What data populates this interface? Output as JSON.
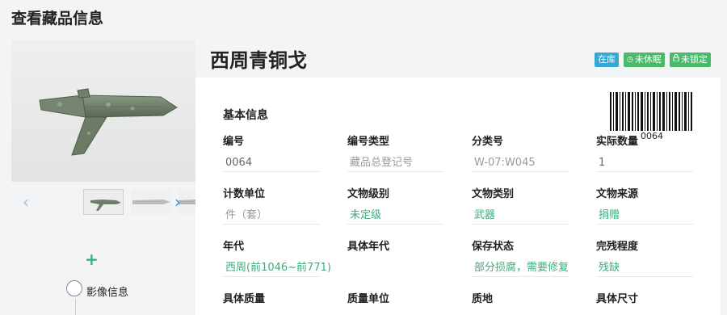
{
  "page": {
    "title": "查看藏品信息"
  },
  "object": {
    "title": "西周青铜戈",
    "badges": [
      {
        "label": "在库",
        "color": "#35a9d4"
      },
      {
        "label": "未休眠",
        "icon": "clock-icon",
        "color": "#4cb86a"
      },
      {
        "label": "未锁定",
        "icon": "lock-icon",
        "color": "#4cb86a"
      }
    ],
    "barcode_number": "0064"
  },
  "sidebar": {
    "media_label": "影像信息",
    "add_icon": "plus-icon",
    "prev_icon": "chevron-left-icon",
    "next_icon": "chevron-right-icon"
  },
  "basic_info": {
    "title": "基本信息",
    "fields": [
      {
        "label": "编号",
        "value": "0064"
      },
      {
        "label": "编号类型",
        "value": "藏品总登记号"
      },
      {
        "label": "分类号",
        "value": "W-07:W045"
      },
      {
        "label": "实际数量",
        "value": "1"
      },
      {
        "label": "计数单位",
        "value": "件（套）"
      },
      {
        "label": "文物级别",
        "value": "未定级"
      },
      {
        "label": "文物类别",
        "value": "武器"
      },
      {
        "label": "文物来源",
        "value": "捐赠"
      },
      {
        "label": "年代",
        "value": "西周(前1046~前771)"
      },
      {
        "label": "具体年代",
        "value": ""
      },
      {
        "label": "保存状态",
        "value": "部分损腐，需要修复"
      },
      {
        "label": "完残程度",
        "value": "残缺"
      },
      {
        "label": "具体质量",
        "value": ""
      },
      {
        "label": "质量单位",
        "value": ""
      },
      {
        "label": "质地",
        "value": ""
      },
      {
        "label": "具体尺寸",
        "value": ""
      }
    ]
  },
  "colors": {
    "accent": "#3aae7a",
    "link": "#3a8ee6"
  }
}
